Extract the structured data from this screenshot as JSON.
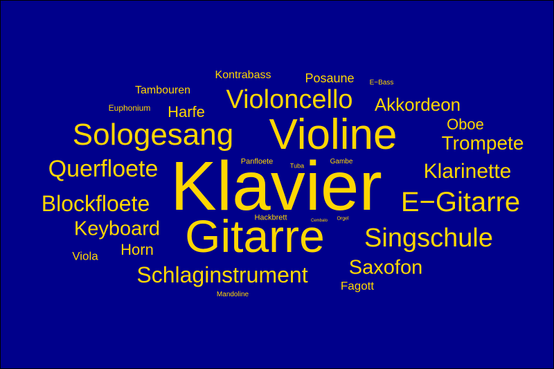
{
  "colors": {
    "background": "#00008b",
    "text": "#ffd700"
  },
  "words": {
    "klavier": "Klavier",
    "violine": "Violine",
    "gitarre": "Gitarre",
    "sologesang": "Sologesang",
    "violoncello": "Violoncello",
    "egitarre": "E−Gitarre",
    "singschule": "Singschule",
    "querfloete": "Querfloete",
    "blockfloete": "Blockfloete",
    "klarinette": "Klarinette",
    "schlaginstrument": "Schlaginstrument",
    "saxofon": "Saxofon",
    "keyboard": "Keyboard",
    "trompete": "Trompete",
    "akkordeon": "Akkordeon",
    "harfe": "Harfe",
    "horn": "Horn",
    "oboe": "Oboe",
    "posaune": "Posaune",
    "kontrabass": "Kontrabass",
    "tambouren": "Tambouren",
    "fagott": "Fagott",
    "viola": "Viola",
    "euphonium": "Euphonium",
    "panfloete": "Panfloete",
    "hackbrett": "Hackbrett",
    "gambe": "Gambe",
    "tuba": "Tuba",
    "ebass": "E−Bass",
    "mandoline": "Mandoline",
    "cembalo": "Cembalo",
    "orgel": "Orgel"
  }
}
